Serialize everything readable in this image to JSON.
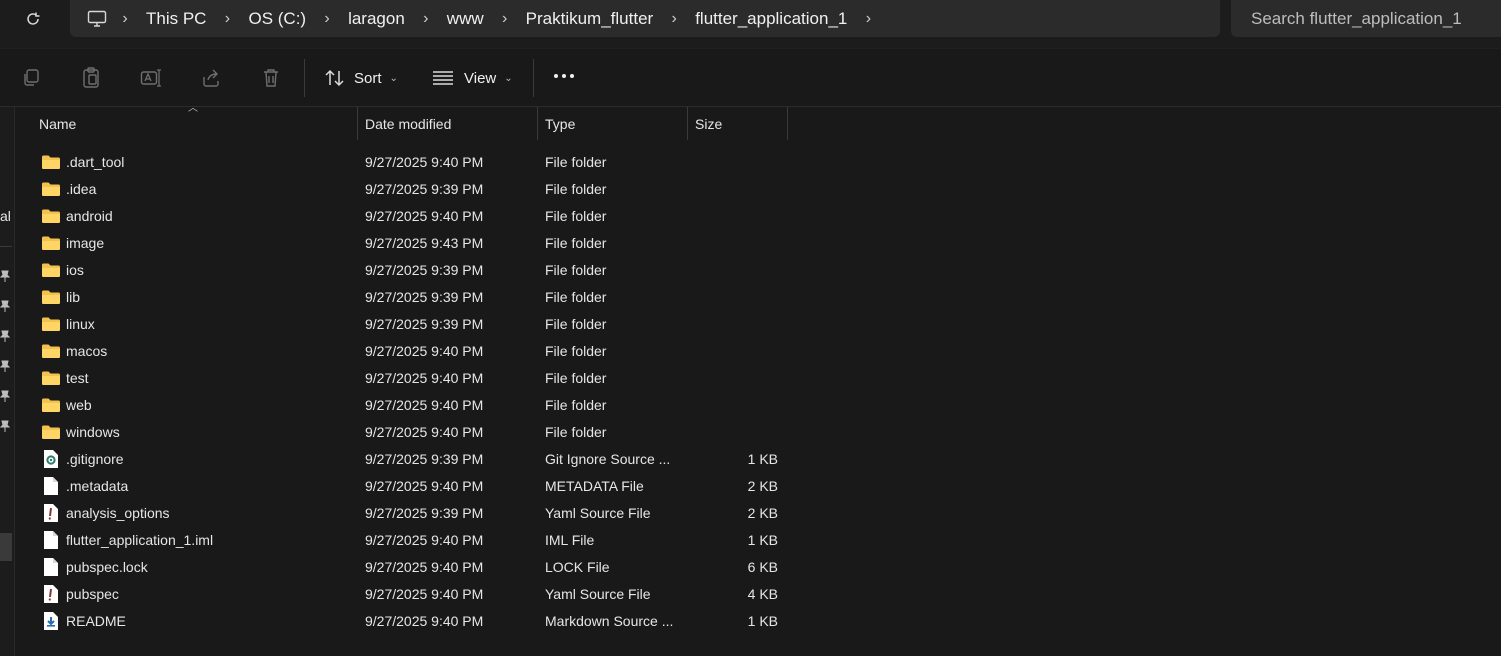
{
  "address": {
    "crumbs": [
      "This PC",
      "OS (C:)",
      "laragon",
      "www",
      "Praktikum_flutter",
      "flutter_application_1"
    ]
  },
  "search": {
    "placeholder": "Search flutter_application_1"
  },
  "toolbar": {
    "sort_label": "Sort",
    "view_label": "View",
    "more_label": "..."
  },
  "nav": {
    "partial_label": "al"
  },
  "columns": {
    "name": "Name",
    "date": "Date modified",
    "type": "Type",
    "size": "Size"
  },
  "files": [
    {
      "name": ".dart_tool",
      "date": "9/27/2025 9:40 PM",
      "type": "File folder",
      "size": "",
      "icon": "folder"
    },
    {
      "name": ".idea",
      "date": "9/27/2025 9:39 PM",
      "type": "File folder",
      "size": "",
      "icon": "folder"
    },
    {
      "name": "android",
      "date": "9/27/2025 9:40 PM",
      "type": "File folder",
      "size": "",
      "icon": "folder"
    },
    {
      "name": "image",
      "date": "9/27/2025 9:43 PM",
      "type": "File folder",
      "size": "",
      "icon": "folder"
    },
    {
      "name": "ios",
      "date": "9/27/2025 9:39 PM",
      "type": "File folder",
      "size": "",
      "icon": "folder"
    },
    {
      "name": "lib",
      "date": "9/27/2025 9:39 PM",
      "type": "File folder",
      "size": "",
      "icon": "folder"
    },
    {
      "name": "linux",
      "date": "9/27/2025 9:39 PM",
      "type": "File folder",
      "size": "",
      "icon": "folder"
    },
    {
      "name": "macos",
      "date": "9/27/2025 9:40 PM",
      "type": "File folder",
      "size": "",
      "icon": "folder"
    },
    {
      "name": "test",
      "date": "9/27/2025 9:40 PM",
      "type": "File folder",
      "size": "",
      "icon": "folder"
    },
    {
      "name": "web",
      "date": "9/27/2025 9:40 PM",
      "type": "File folder",
      "size": "",
      "icon": "folder"
    },
    {
      "name": "windows",
      "date": "9/27/2025 9:40 PM",
      "type": "File folder",
      "size": "",
      "icon": "folder"
    },
    {
      "name": ".gitignore",
      "date": "9/27/2025 9:39 PM",
      "type": "Git Ignore Source ...",
      "size": "1 KB",
      "icon": "gear-file"
    },
    {
      "name": ".metadata",
      "date": "9/27/2025 9:40 PM",
      "type": "METADATA File",
      "size": "2 KB",
      "icon": "file"
    },
    {
      "name": "analysis_options",
      "date": "9/27/2025 9:39 PM",
      "type": "Yaml Source File",
      "size": "2 KB",
      "icon": "yaml-file"
    },
    {
      "name": "flutter_application_1.iml",
      "date": "9/27/2025 9:40 PM",
      "type": "IML File",
      "size": "1 KB",
      "icon": "file"
    },
    {
      "name": "pubspec.lock",
      "date": "9/27/2025 9:40 PM",
      "type": "LOCK File",
      "size": "6 KB",
      "icon": "file"
    },
    {
      "name": "pubspec",
      "date": "9/27/2025 9:40 PM",
      "type": "Yaml Source File",
      "size": "4 KB",
      "icon": "yaml-file"
    },
    {
      "name": "README",
      "date": "9/27/2025 9:40 PM",
      "type": "Markdown Source ...",
      "size": "1 KB",
      "icon": "markdown-file"
    }
  ]
}
